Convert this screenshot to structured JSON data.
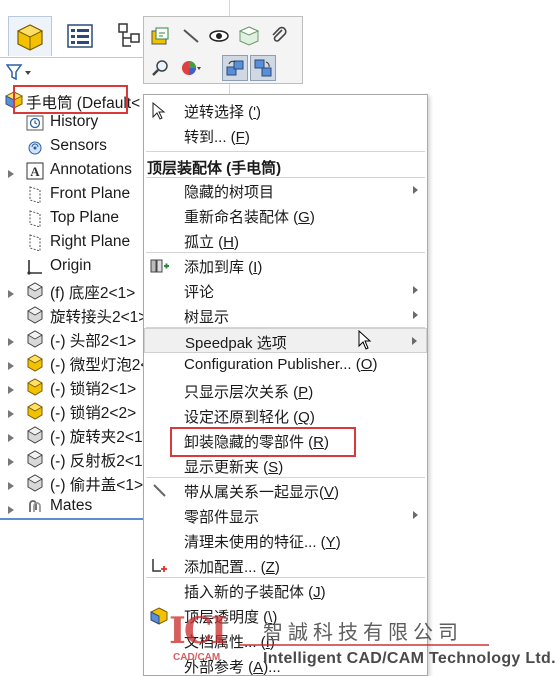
{
  "feature_tree": {
    "root": {
      "label": "手电筒  (Default<",
      "suffix": "Default-Di"
    },
    "items": [
      {
        "label": "History",
        "icon": "history-icon",
        "expandable": false
      },
      {
        "label": "Sensors",
        "icon": "sensor-icon",
        "expandable": false
      },
      {
        "label": "Annotations",
        "icon": "annotation-icon",
        "expandable": true
      },
      {
        "label": "Front Plane",
        "icon": "plane-icon",
        "expandable": false
      },
      {
        "label": "Top Plane",
        "icon": "plane-icon",
        "expandable": false
      },
      {
        "label": "Right Plane",
        "icon": "plane-icon",
        "expandable": false
      },
      {
        "label": "Origin",
        "icon": "origin-icon",
        "expandable": false
      },
      {
        "label": "(f) 底座2<1>",
        "icon": "part-icon",
        "expandable": true
      },
      {
        "label": "旋转接头2<1>",
        "icon": "part-icon",
        "expandable": false
      },
      {
        "label": "(-) 头部2<1>",
        "icon": "part-icon",
        "expandable": true
      },
      {
        "label": "(-) 微型灯泡2<",
        "icon": "subassembly-icon",
        "expandable": true
      },
      {
        "label": "(-) 锁销2<1>",
        "icon": "subassembly-icon",
        "expandable": true
      },
      {
        "label": "(-) 锁销2<2>",
        "icon": "subassembly-icon",
        "expandable": true
      },
      {
        "label": "(-) 旋转夹2<1",
        "icon": "part-icon",
        "expandable": true
      },
      {
        "label": "(-) 反射板2<1",
        "icon": "part-icon",
        "expandable": true
      },
      {
        "label": "(-) 偷井盖<1>",
        "icon": "part-icon",
        "expandable": true
      },
      {
        "label": "Mates",
        "icon": "mates-icon",
        "expandable": true
      }
    ]
  },
  "context_menu": {
    "top_items": [
      {
        "label": "逆转选择 (",
        "key": "'",
        "close": ")",
        "icon": "select-arrow-icon"
      },
      {
        "label": "转到... (",
        "key": "F",
        "close": ")"
      }
    ],
    "header": "顶层装配体 (手电筒)",
    "items": [
      {
        "label": "隐藏的树项目",
        "submenu": true
      },
      {
        "label": "重新命名装配体 (",
        "key": "G",
        "close": ")"
      },
      {
        "label": "孤立 (",
        "key": "H",
        "close": ")"
      },
      {
        "label": "添加到库 (",
        "key": "I",
        "close": ")",
        "icon": "add-to-library-icon"
      },
      {
        "label": "评论",
        "submenu": true
      },
      {
        "label": "树显示",
        "submenu": true
      },
      {
        "label": "Speedpak 选项",
        "submenu": true,
        "hover": true
      },
      {
        "label": "Configuration Publisher... (",
        "key": "O",
        "close": ")"
      },
      {
        "label": "只显示层次关系 (",
        "key": "P",
        "close": ")"
      },
      {
        "label": "设定还原到轻化 (",
        "key": "Q",
        "close": ")"
      },
      {
        "label": "卸装隐藏的零部件 (",
        "key": "R",
        "close": ")"
      },
      {
        "label": "显示更新夹 (",
        "key": "S",
        "close": ")"
      },
      {
        "label": "带从属关系一起显示(",
        "key": "V",
        "close": ")",
        "icon": "show-with-dependents-icon"
      },
      {
        "label": "零部件显示",
        "submenu": true
      },
      {
        "label": "清理未使用的特征... (",
        "key": "Y",
        "close": ")"
      },
      {
        "label": "添加配置... (",
        "key": "Z",
        "close": ")",
        "icon": "add-configuration-icon"
      },
      {
        "label": "插入新的子装配体 (",
        "key": "J",
        "close": ")"
      },
      {
        "label": "顶层透明度 (",
        "key": "\\",
        "close": ")",
        "icon": "transparency-icon"
      },
      {
        "label": "文档属性... (",
        "key": "I",
        "close": ")"
      },
      {
        "label": "外部参考 (",
        "key": "A",
        "close": ")..."
      }
    ]
  },
  "watermark": {
    "logo": "ICI",
    "logo_sub": "CAD/CAM",
    "company_cn": "智誠科技有限公司",
    "company_en": "Intelligent CAD/CAM Technology Ltd."
  },
  "colors": {
    "highlight": "#d83a3a",
    "selection_line": "#5b8fd0",
    "assembly_yellow": "#f2c200"
  }
}
